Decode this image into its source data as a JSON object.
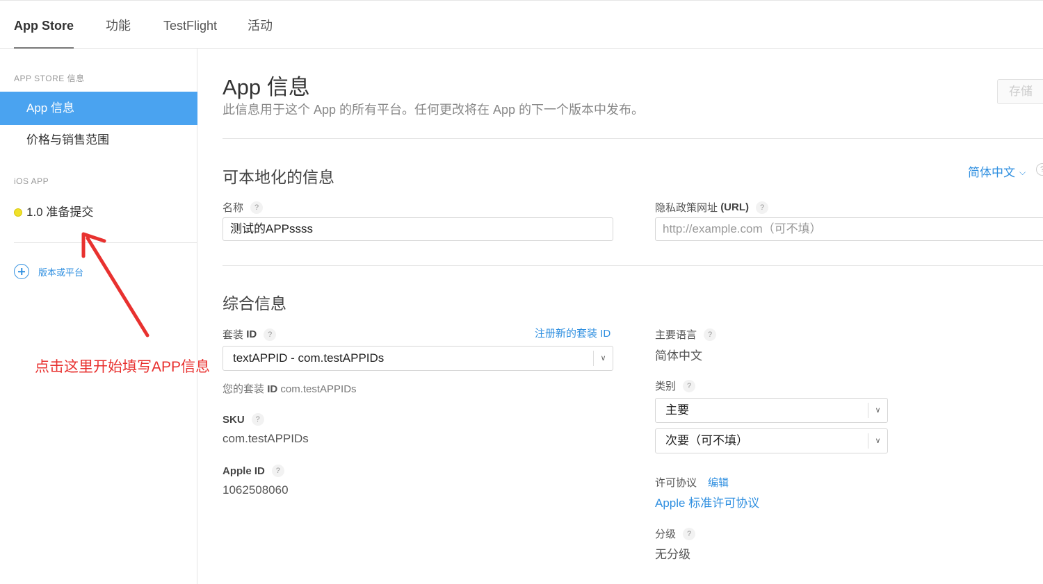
{
  "topnav": {
    "tabs": [
      {
        "label": "App Store",
        "active": true
      },
      {
        "label": "功能"
      },
      {
        "label": "TestFlight"
      },
      {
        "label": "活动"
      }
    ]
  },
  "sidebar": {
    "heading_store": "APP STORE 信息",
    "items": [
      {
        "label": "App 信息",
        "active": true
      },
      {
        "label": "价格与销售范围"
      }
    ],
    "heading_ios": "iOS APP",
    "version_item": "1.0 准备提交",
    "version_status_color": "#f0e12a",
    "add_platform": "版本或平台"
  },
  "annotation": {
    "text": "点击这里开始填写APP信息",
    "color": "#e8312f"
  },
  "header": {
    "title": "App 信息",
    "subtitle": "此信息用于这个 App 的所有平台。任何更改将在 App 的下一个版本中发布。",
    "save_label": "存储"
  },
  "localizable": {
    "title": "可本地化的信息",
    "language": "简体中文",
    "name_label": "名称",
    "name_value": "测试的APPssss",
    "privacy_label_prefix": "隐私政策网址",
    "privacy_label_bold": "(URL)",
    "privacy_placeholder": "http://example.com（可不填）"
  },
  "general": {
    "title": "综合信息",
    "bundle_label": "套装",
    "bundle_label_bold": "ID",
    "register_bundle_link": "注册新的套装 ID",
    "bundle_select_value": "textAPPID - com.testAPPIDs",
    "your_bundle_prefix": "您的套装",
    "your_bundle_bold": "ID",
    "your_bundle_value": "com.testAPPIDs",
    "sku_label": "SKU",
    "sku_value": "com.testAPPIDs",
    "apple_id_label": "Apple ID",
    "apple_id_value": "1062508060",
    "primary_lang_label": "主要语言",
    "primary_lang_value": "简体中文",
    "category_label": "类别",
    "category_primary": "主要",
    "category_secondary": "次要（可不填）",
    "license_label": "许可协议",
    "license_edit": "编辑",
    "license_value": "Apple 标准许可协议",
    "rating_label": "分级",
    "rating_value": "无分级"
  },
  "colors": {
    "accent": "#2f8fe0",
    "sidebar_active": "#4aa3f0"
  }
}
